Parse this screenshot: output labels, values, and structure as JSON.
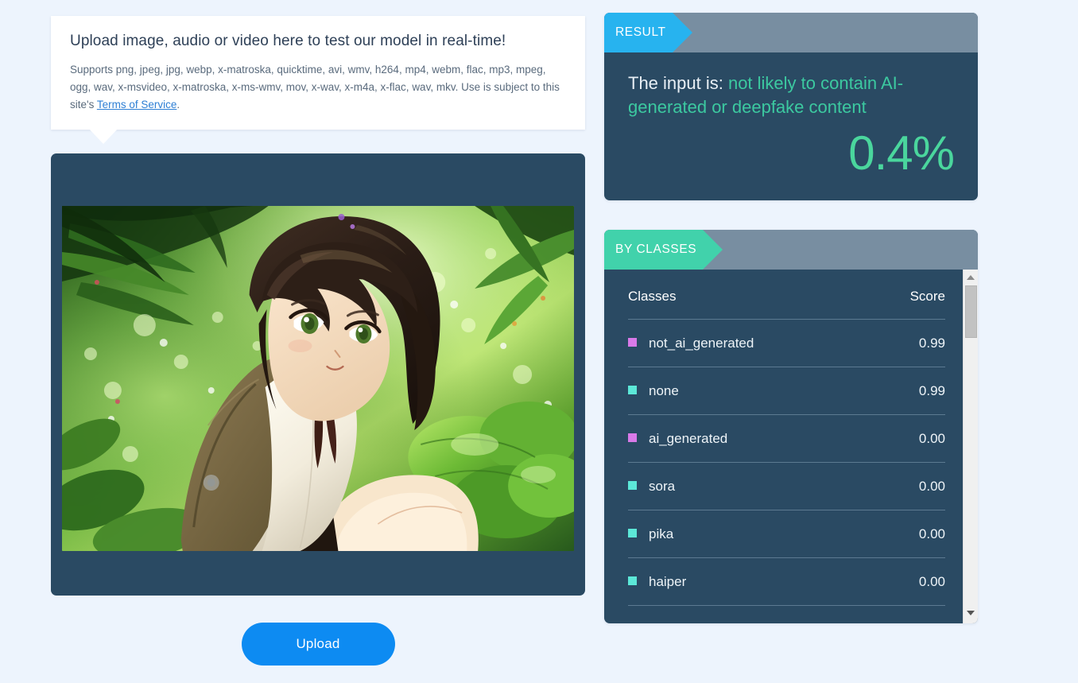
{
  "info_card": {
    "title": "Upload image, audio or video here to test our model in real-time!",
    "supports_text": "Supports png, jpeg, jpg, webp, x-matroska, quicktime, avi, wmv, h264, mp4, webm, flac, mp3, mpeg, ogg, wav, x-msvideo, x-matroska, x-ms-wmv, mov, x-wav, x-m4a, x-flac, wav, mkv. Use is subject to this site's ",
    "link_label": "Terms of Service",
    "period": "."
  },
  "preview": {
    "media_alt": "anime-girl-in-green-foliage-preview"
  },
  "upload": {
    "button_label": "Upload"
  },
  "result_panel": {
    "tag_label": "RESULT",
    "prefix": "The input is: ",
    "verdict": "not likely to contain AI-generated or deepfake content",
    "percentage": "0.4%",
    "accent_color": "#4ad69d",
    "tag_color": "#27b3ef"
  },
  "classes_panel": {
    "tag_label": "BY CLASSES",
    "tag_color": "#41d2ab",
    "header": {
      "classes": "Classes",
      "score": "Score"
    },
    "rows": [
      {
        "name": "not_ai_generated",
        "score": "0.99",
        "color": "#d97ae8"
      },
      {
        "name": "none",
        "score": "0.99",
        "color": "#5ce8d8"
      },
      {
        "name": "ai_generated",
        "score": "0.00",
        "color": "#d97ae8"
      },
      {
        "name": "sora",
        "score": "0.00",
        "color": "#5ce8d8"
      },
      {
        "name": "pika",
        "score": "0.00",
        "color": "#5ce8d8"
      },
      {
        "name": "haiper",
        "score": "0.00",
        "color": "#5ce8d8"
      }
    ]
  },
  "theme": {
    "page_background": "#edf4fd",
    "panel_background": "#2a4a63",
    "panel_header_background": "#788ea1",
    "upload_button_color": "#0d8bf2"
  }
}
